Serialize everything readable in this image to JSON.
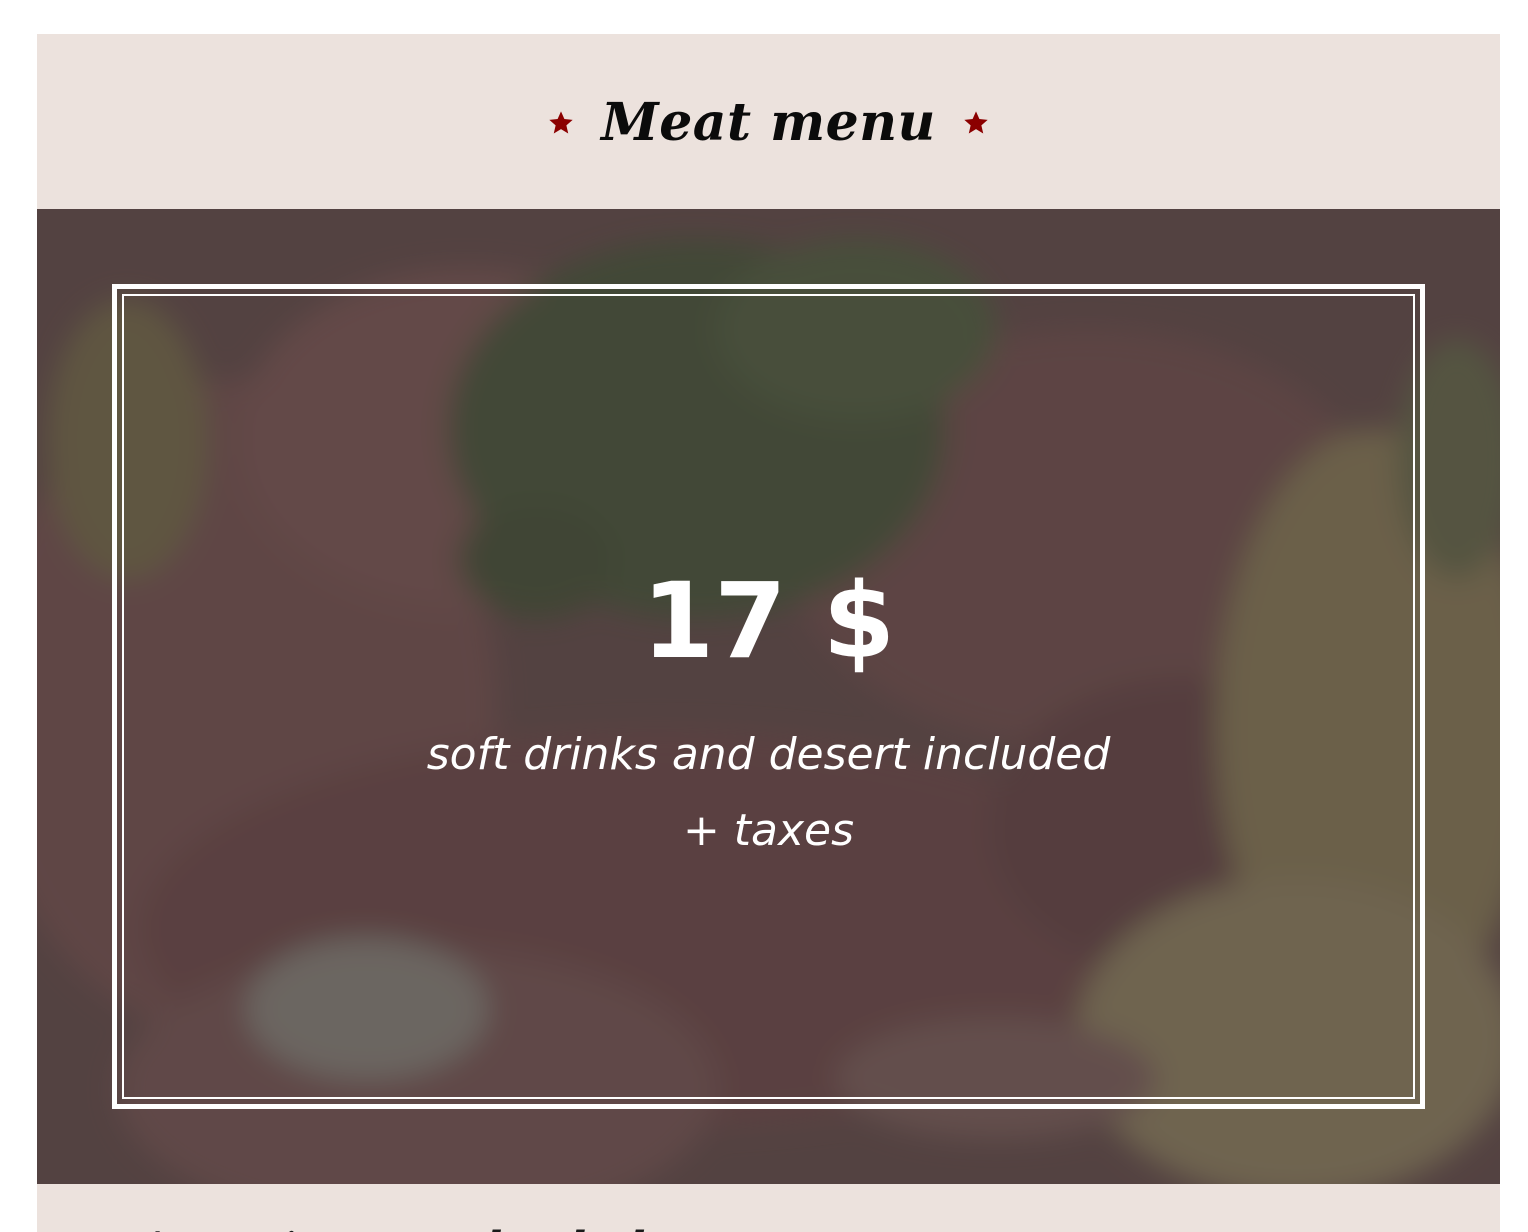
{
  "menu": {
    "title": "Meat menu",
    "title_icon_left": "star-icon",
    "title_icon_right": "star-icon",
    "star_color": "#8b0000"
  },
  "offer": {
    "price": "17 $",
    "line1": "soft drinks and desert included",
    "line2": "+ taxes"
  },
  "colors": {
    "background": "#ece2dd",
    "frame": "#ffffff",
    "overlay": "#3c3436"
  },
  "next_section": {
    "title": "Appetizers and salads"
  }
}
